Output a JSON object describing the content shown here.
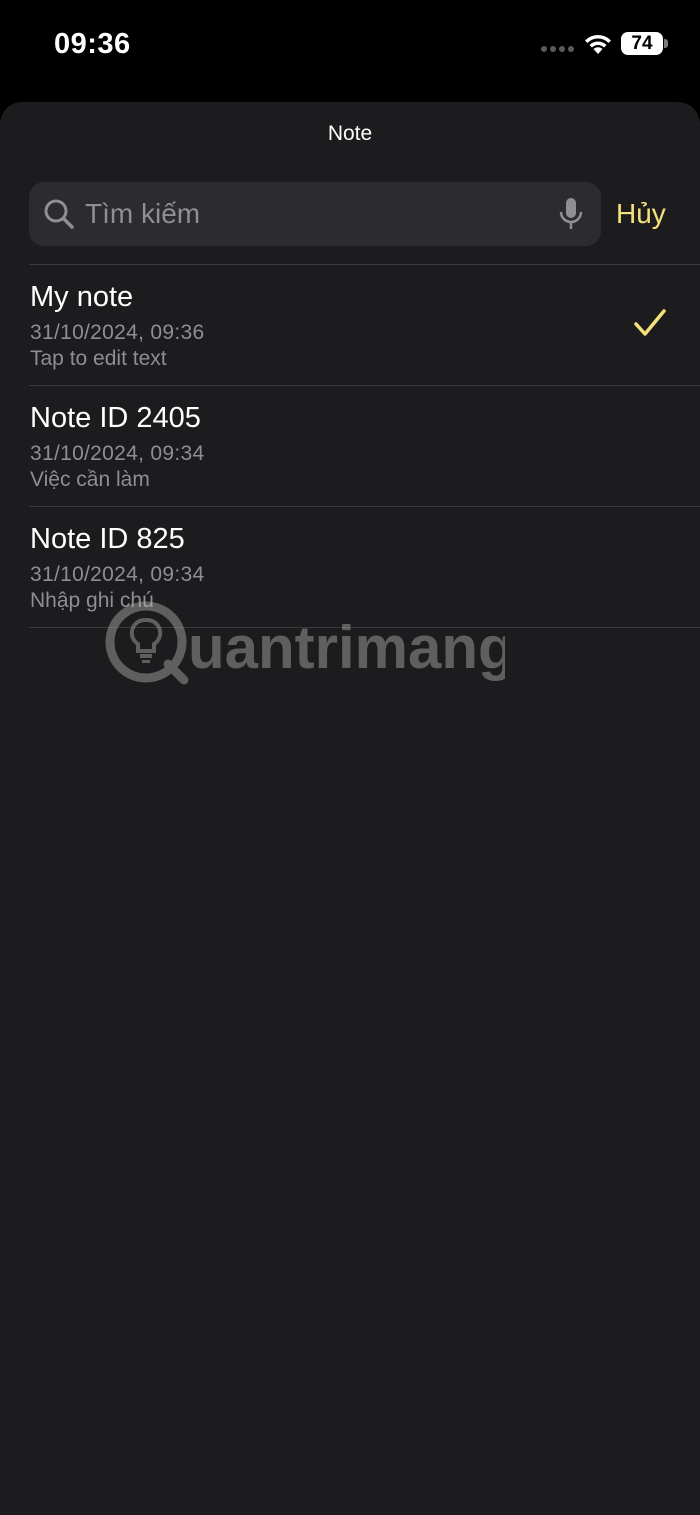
{
  "status_bar": {
    "time": "09:36",
    "battery": "74"
  },
  "sheet": {
    "title": "Note"
  },
  "search": {
    "placeholder": "Tìm kiếm",
    "value": "",
    "cancel_label": "Hủy"
  },
  "notes": [
    {
      "title": "My note",
      "date": "31/10/2024, 09:36",
      "subtitle": "Tap to edit text",
      "selected": true
    },
    {
      "title": "Note ID 2405",
      "date": "31/10/2024, 09:34",
      "subtitle": "Việc cần làm",
      "selected": false
    },
    {
      "title": "Note ID 825",
      "date": "31/10/2024, 09:34",
      "subtitle": "Nhập ghi chú",
      "selected": false
    }
  ],
  "watermark": {
    "text": "uantrimang"
  },
  "icons": {
    "search": "search-icon",
    "mic": "microphone-icon",
    "check": "checkmark-icon",
    "wifi": "wifi-icon",
    "signal": "cellular-signal-icon",
    "battery": "battery-icon"
  },
  "colors": {
    "background": "#1c1c1e",
    "search_field": "#2c2c2e",
    "accent": "#f5e17a",
    "secondary_text": "#8e8e93",
    "separator": "#3a3a3c"
  }
}
